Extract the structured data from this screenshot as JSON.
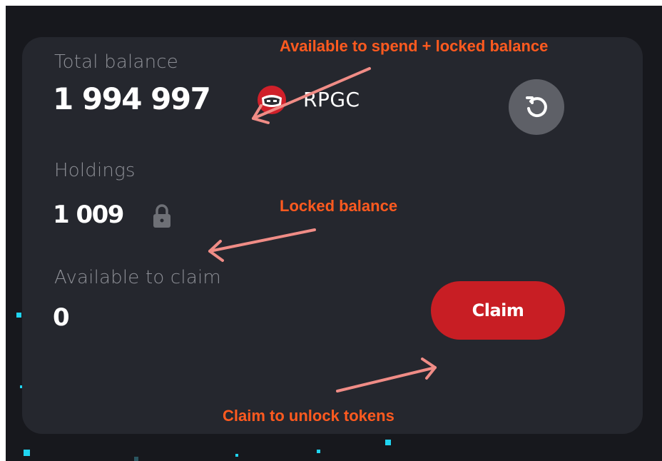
{
  "wallet": {
    "total_balance_label": "Total balance",
    "total_balance_value": "1 994 997",
    "token_symbol": "RPGC",
    "token_icon": "rpgc-token-icon",
    "refresh_icon": "refresh-icon",
    "holdings_label": "Holdings",
    "holdings_value": "1 009",
    "holdings_icon": "lock-icon",
    "available_label": "Available to claim",
    "available_value": "0",
    "claim_label": "Claim"
  },
  "annotations": {
    "total_balance_note": "Available to spend + locked balance",
    "holdings_note": "Locked balance",
    "claim_note": "Claim to unlock tokens"
  },
  "colors": {
    "background": "#17181d",
    "panel": "#25272e",
    "claim_button": "#c81e24",
    "refresh_button": "#5e6067",
    "annotation_text": "#ff5a1f",
    "annotation_arrow": "#f08c86",
    "particle": "#20d4f0"
  }
}
